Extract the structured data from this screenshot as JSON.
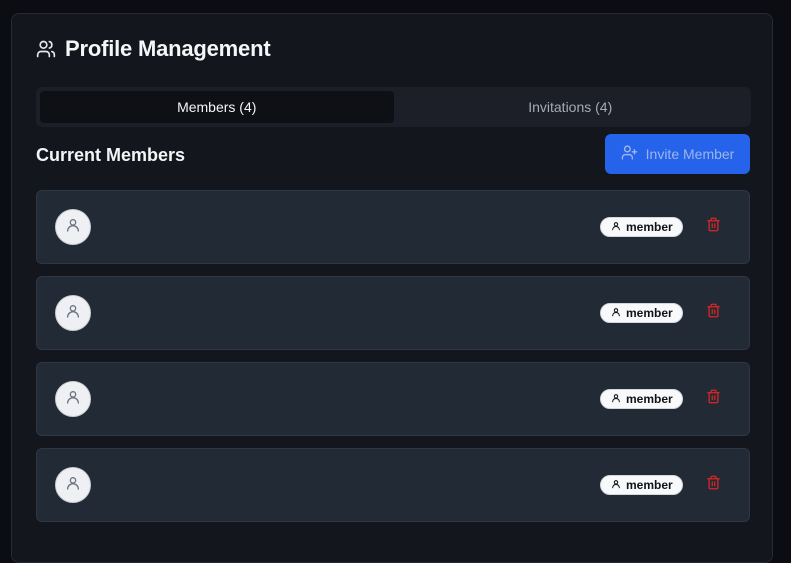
{
  "header": {
    "title": "Profile Management",
    "icon": "users-icon"
  },
  "tabs": [
    {
      "label": "Members (4)",
      "active": true
    },
    {
      "label": "Invitations (4)",
      "active": false
    }
  ],
  "section": {
    "title": "Current Members"
  },
  "invite_button": {
    "label": "Invite Member",
    "icon": "user-plus-icon"
  },
  "members": [
    {
      "role": "member",
      "avatar_icon": "user-icon",
      "delete_icon": "trash-icon"
    },
    {
      "role": "member",
      "avatar_icon": "user-icon",
      "delete_icon": "trash-icon"
    },
    {
      "role": "member",
      "avatar_icon": "user-icon",
      "delete_icon": "trash-icon"
    },
    {
      "role": "member",
      "avatar_icon": "user-icon",
      "delete_icon": "trash-icon"
    }
  ],
  "colors": {
    "background": "#0b0d12",
    "panel": "#13161d",
    "accent": "#2563eb",
    "danger": "#dc2626",
    "row": "#222a36"
  }
}
